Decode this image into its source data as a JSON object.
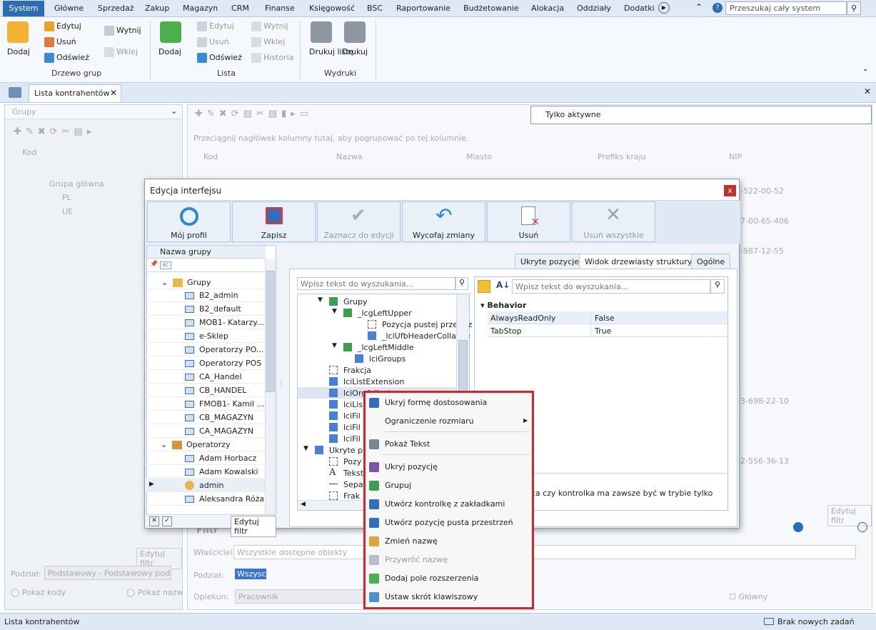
{
  "menu": {
    "active": "System",
    "items": [
      "Główne",
      "Sprzedaż",
      "Zakup",
      "Magazyn",
      "CRM",
      "Finanse",
      "Księgowość",
      "BSC",
      "Raportowanie",
      "Budżetowanie",
      "Alokacja",
      "Oddziały",
      "Dodatki"
    ],
    "search_placeholder": "Przeszukaj cały system"
  },
  "ribbon": {
    "dodaj": "Dodaj",
    "edytuj": "Edytuj",
    "usun": "Usuń",
    "odswiez": "Odśwież",
    "wytnij": "Wytnij",
    "wklej": "Wklej",
    "group1": "Drzewo grup",
    "dodaj2": "Dodaj",
    "edytuj2": "Edytuj",
    "usun2": "Usuń",
    "odswiez2": "Odśwież",
    "wytnij2": "Wytnij",
    "wklej2": "Wklej",
    "historia": "Historia",
    "group2": "Lista",
    "drukuj_liste": "Drukuj listę",
    "drukuj": "Drukuj",
    "group3": "Wydruki"
  },
  "doc_tab": "Lista kontrahentów",
  "left": {
    "groups_label": "Grupy",
    "kod": "Kod",
    "tree": [
      "Grupa główna",
      "PL",
      "UE"
    ],
    "edytuj_filtr": "Edytuj filtr",
    "podzial": "Podział:",
    "podzial_val": "Podstawowy - Podstawowy podz",
    "pokaz_kody": "Pokaż kody",
    "pokaz_nazwy": "Pokaż nazw"
  },
  "right": {
    "tylko_aktywne": "Tylko aktywne",
    "drag_hint": "Przeciągnij nagłówek kolumny tutaj, aby pogrupować po tej kolumnie.",
    "cols": [
      "Kod",
      "Nazwa",
      "Miasto",
      "Prefiks kraju",
      "NIP"
    ],
    "nips": [
      "-522-00-52",
      "7-00-65-406",
      "-987-12-55",
      "3-698-22-10",
      "2-556-36-13"
    ],
    "edytuj_filtr": "Edytuj filtr",
    "filtr": "Filtr",
    "wlasciciel": "Właściciel:",
    "wlasciciel_val": "Wszystkie dostępne obiekty",
    "podzial": "Podział:",
    "podzial_val": "Wszyscy",
    "opiekun": "Opiekun:",
    "opiekun_val": "Pracownik",
    "glowny": "Główny"
  },
  "status": {
    "left": "Lista kontrahentów",
    "right": "Brak nowych zadań"
  },
  "dialog": {
    "title": "Edycja interfejsu",
    "buttons": [
      "Mój profil",
      "Zapisz",
      "Zaznacz do edycji",
      "Wycofaj zmiany",
      "Usuń",
      "Usuń wszystkie"
    ],
    "group_header": "Nazwa grupy",
    "groups_root": "Grupy",
    "group_items": [
      "B2_admin",
      "B2_default",
      "MOB1- Katarzy...",
      "e-Sklep",
      "Operatorzy PO...",
      "Operatorzy POS",
      "CA_Handel",
      "CB_HANDEL",
      "FMOB1- Kamil ...",
      "CB_MAGAZYN",
      "CA_MAGAZYN"
    ],
    "operators_root": "Operatorzy",
    "operator_items": [
      "Adam Horbacz",
      "Adam Kowalski",
      "admin",
      "Aleksandra Róża"
    ],
    "edytuj_filtr": "Edytuj filtr",
    "tabs": [
      "Ukryte pozycje",
      "Widok drzewiasty struktury",
      "Ogólne"
    ],
    "search_placeholder": "Wpisz tekst do wyszukania...",
    "tree": [
      "Grupy",
      "_lcgLeftUpper",
      "Pozycja pustej przestrz",
      "_lciUfbHeaderCollapse",
      "_lcgLeftMiddle",
      "lciGroups",
      "Frakcja",
      "lciListExtension",
      "lciOrgAdjust",
      "lciLis",
      "lciFil",
      "lciFil",
      "lciFil",
      "Ukryte p",
      "Pozy",
      "Tekst",
      "Sepa",
      "Frak"
    ],
    "props_search_placeholder": "Wpisz tekst do wyszukania...",
    "behavior": "Behavior",
    "props": [
      {
        "name": "AlwaysReadOnly",
        "value": "False"
      },
      {
        "name": "TabStop",
        "value": "True"
      }
    ],
    "desc_title": "ly",
    "desc_text": "ująca czy kontrolka ma zawsze być w trybie tylko"
  },
  "context_menu": [
    {
      "label": "Ukryj formę dostosowania",
      "icon": "wrench-icon"
    },
    {
      "label": "Ograniczenie rozmiaru",
      "icon": "none",
      "submenu": true
    },
    {
      "label": "Pokaż Tekst",
      "icon": "text-icon"
    },
    {
      "label": "Ukryj pozycję",
      "icon": "eye-icon"
    },
    {
      "label": "Grupuj",
      "icon": "group-icon"
    },
    {
      "label": "Utwórz kontrolkę z zakładkami",
      "icon": "tabs-icon"
    },
    {
      "label": "Utwórz pozycję pusta przestrzeń",
      "icon": "empty-space-icon"
    },
    {
      "label": "Zmień nazwę",
      "icon": "rename-icon"
    },
    {
      "label": "Przywróć nazwę",
      "icon": "restore-icon",
      "disabled": true
    },
    {
      "label": "Dodaj pole rozszerzenia",
      "icon": "plus-icon"
    },
    {
      "label": "Ustaw skrót klawiszowy",
      "icon": "shortcut-icon"
    }
  ]
}
